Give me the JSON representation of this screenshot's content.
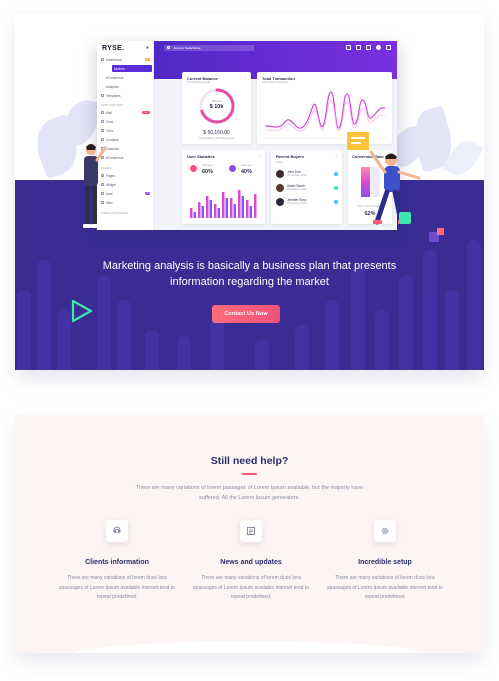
{
  "hero": {
    "headline": "Marketing analysis is basically a business plan that presents information regarding the market",
    "cta_label": "Contact Us Now"
  },
  "dashboard": {
    "brand": "RYSE.",
    "search_placeholder": "Explore Nakarfellow",
    "nav": [
      {
        "label": "Dashboard",
        "badge": "4"
      },
      {
        "label": "Modern",
        "active": true
      },
      {
        "label": "eCommerce"
      },
      {
        "label": "Analytics"
      },
      {
        "label": "Templates"
      },
      {
        "header": "APPLICATIONS"
      },
      {
        "label": "Mail",
        "badge": "new"
      },
      {
        "label": "Chat"
      },
      {
        "label": "ToDo"
      },
      {
        "label": "Contacts"
      },
      {
        "label": "Calendar"
      },
      {
        "label": "eCommerce"
      },
      {
        "header": "PAGES"
      },
      {
        "label": "Pages"
      },
      {
        "label": "Widget"
      },
      {
        "label": "User",
        "badge": "2"
      },
      {
        "label": "Misc"
      },
      {
        "header": "USER INTERFACE"
      }
    ],
    "balance": {
      "title": "Current Balance",
      "sub": "The balancing cycle",
      "ring_label": "Balance",
      "ring_value": "$ 10k",
      "amount": "$ 50,150.00",
      "amount_sub": "Used balance this billing cycle"
    },
    "transaction": {
      "title": "Total Transaction",
      "sub": "Last month transaction"
    },
    "user_stats": {
      "title": "User Statistics",
      "stat1_label": "This year",
      "stat1_value": "60%",
      "stat2_label": "Last year",
      "stat2_value": "40%"
    },
    "recent_buyers": {
      "title": "Recent Buyers",
      "period": "Today",
      "buyers": [
        {
          "name": "John Doe",
          "date": "25 January 2019"
        },
        {
          "name": "Adam Sarah",
          "date": "25 January 2019"
        },
        {
          "name": "Jennifer Rose",
          "date": "25 January 2019"
        }
      ]
    },
    "conversion": {
      "title": "Conversion Rate",
      "sub": "This month conversion",
      "value": "62%"
    },
    "colors": {
      "primary": "#5a2bd6",
      "accent": "#ff4f7a",
      "hero_bg": "#3a2c93"
    }
  },
  "help": {
    "title": "Still need help?",
    "description": "There are many variations of lorem passages of Lorem Ipsum available, but the majority have suffered. All the Lorem Ipsum generators.",
    "features": [
      {
        "icon": "support-icon",
        "title": "Clients information",
        "text": "There are many variations of lorem duos lora spassages of Lorem Ipsum available internet tend to repeat predefined."
      },
      {
        "icon": "newspaper-icon",
        "title": "News and updates",
        "text": "There are many variations of lorem duos lora spassages of Lorem Ipsum available internet tend to repeat predefined."
      },
      {
        "icon": "gear-icon",
        "title": "Incredible setup",
        "text": "There are many variations of lorem duos lora spassages of Lorem Ipsum available internet tend to repeat predefined."
      }
    ]
  }
}
